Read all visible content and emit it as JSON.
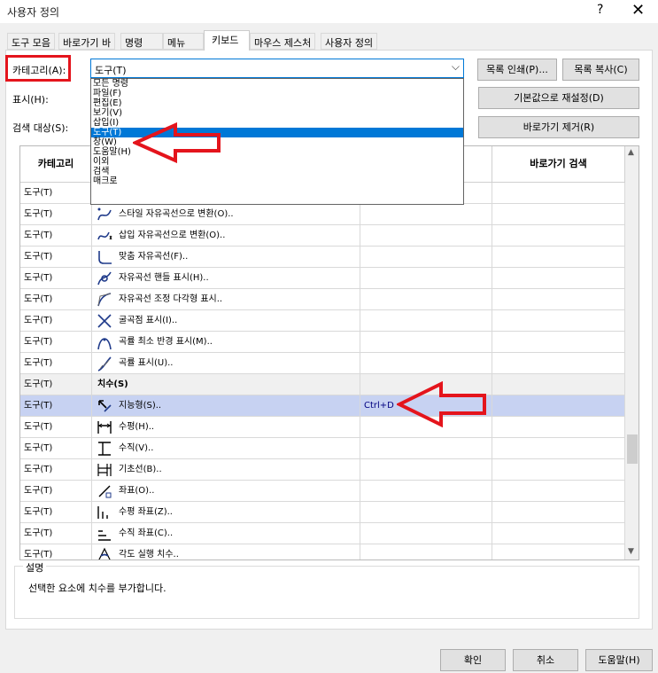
{
  "window": {
    "title": "사용자 정의",
    "help_glyph": "?",
    "close_glyph": "✕"
  },
  "tabs": [
    "도구 모음",
    "바로가기 바",
    "명령",
    "메뉴",
    "키보드",
    "마우스 제스처",
    "사용자 정의"
  ],
  "filters": {
    "category_label": "카테고리(A):",
    "category_value": "도구(T)",
    "show_label": "표시(H):",
    "search_label": "검색 대상(S):",
    "combo_arrow": "⌵"
  },
  "dropdown_items": [
    "모든 명령",
    "파일(F)",
    "편집(E)",
    "보기(V)",
    "삽입(I)",
    "도구(T)",
    "창(W)",
    "도움말(H)",
    "이외",
    "검색",
    "매크로"
  ],
  "buttons": {
    "print_list": "목록 인쇄(P)...",
    "copy_list": "목록 복사(C)",
    "reset_defaults": "기본값으로 재설정(D)",
    "remove_shortcut": "바로가기 제거(R)",
    "ok": "확인",
    "cancel": "취소",
    "help": "도움말(H)"
  },
  "grid": {
    "headers": [
      "카테고리",
      "",
      "",
      "바로가기 검색"
    ],
    "rows": [
      {
        "category": "도구(T)",
        "icon": "partial-icon",
        "command": "",
        "shortcut": ""
      },
      {
        "category": "도구(T)",
        "icon": "style-spline-icon",
        "command": "스타일 자유곡선으로 변환(O)..",
        "shortcut": ""
      },
      {
        "category": "도구(T)",
        "icon": "insert-spline-icon",
        "command": "삽입 자유곡선으로 변환(O)..",
        "shortcut": ""
      },
      {
        "category": "도구(T)",
        "icon": "fit-spline-icon",
        "command": "맞춤 자유곡선(F)..",
        "shortcut": ""
      },
      {
        "category": "도구(T)",
        "icon": "spline-handles-icon",
        "command": "자유곡선 핸들 표시(H)..",
        "shortcut": ""
      },
      {
        "category": "도구(T)",
        "icon": "control-polygon-icon",
        "command": "자유곡선 조정 다각형 표시..",
        "shortcut": ""
      },
      {
        "category": "도구(T)",
        "icon": "inflection-icon",
        "command": "굴곡점 표시(I)..",
        "shortcut": ""
      },
      {
        "category": "도구(T)",
        "icon": "min-radius-icon",
        "command": "곡률 최소 반경 표시(M)..",
        "shortcut": ""
      },
      {
        "category": "도구(T)",
        "icon": "curvature-icon",
        "command": "곡률 표시(U)..",
        "shortcut": ""
      },
      {
        "category": "도구(T)",
        "icon": "",
        "command": "치수(S)",
        "shortcut": "",
        "section": true
      },
      {
        "category": "도구(T)",
        "icon": "smart-dimension-icon",
        "command": "지능형(S)..",
        "shortcut": "Ctrl+D",
        "selected": true
      },
      {
        "category": "도구(T)",
        "icon": "horizontal-dimension-icon",
        "command": "수평(H)..",
        "shortcut": ""
      },
      {
        "category": "도구(T)",
        "icon": "vertical-dimension-icon",
        "command": "수직(V)..",
        "shortcut": ""
      },
      {
        "category": "도구(T)",
        "icon": "baseline-dimension-icon",
        "command": "기초선(B)..",
        "shortcut": ""
      },
      {
        "category": "도구(T)",
        "icon": "ordinate-dimension-icon",
        "command": "좌표(O)..",
        "shortcut": ""
      },
      {
        "category": "도구(T)",
        "icon": "horizontal-ordinate-icon",
        "command": "수평 좌표(Z)..",
        "shortcut": ""
      },
      {
        "category": "도구(T)",
        "icon": "vertical-ordinate-icon",
        "command": "수직 좌표(C)..",
        "shortcut": ""
      },
      {
        "category": "도구(T)",
        "icon": "angular-running-icon",
        "command": "각도 실행 치수..",
        "shortcut": ""
      }
    ]
  },
  "description": {
    "legend": "설명",
    "text": "선택한 요소에 치수를 부가합니다."
  },
  "colors": {
    "accent": "#0078d7",
    "annotation_red": "#e4141c",
    "selected_row": "#c7d2f2",
    "shortcut_text": "#000080"
  }
}
